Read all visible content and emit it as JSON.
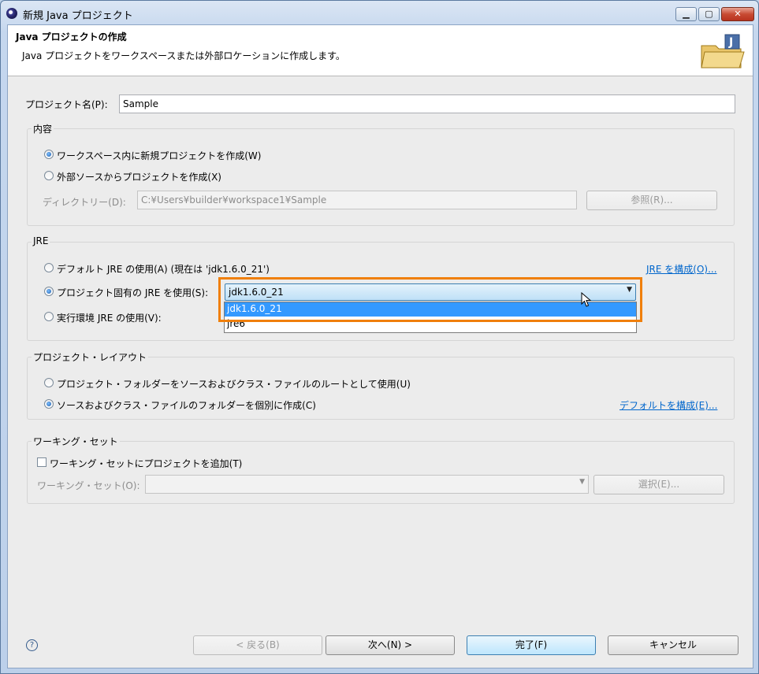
{
  "window": {
    "title": "新規 Java プロジェクト",
    "min_label": "▁",
    "max_label": "▢",
    "close_label": "✕"
  },
  "header": {
    "title": "Java プロジェクトの作成",
    "description": "Java プロジェクトをワークスペースまたは外部ロケーションに作成します。"
  },
  "project_name": {
    "label": "プロジェクト名(P):",
    "value": "Sample"
  },
  "contents": {
    "legend": "内容",
    "option_workspace": "ワークスペース内に新規プロジェクトを作成(W)",
    "option_external": "外部ソースからプロジェクトを作成(X)",
    "directory_label": "ディレクトリー(D):",
    "directory_value": "C:¥Users¥builder¥workspace1¥Sample",
    "browse_button": "参照(R)..."
  },
  "jre": {
    "legend": "JRE",
    "option_default": "デフォルト JRE の使用(A) (現在は 'jdk1.6.0_21')",
    "configure_link": "JRE を構成(O)...",
    "option_project": "プロジェクト固有の JRE を使用(S):",
    "option_env": "実行環境 JRE の使用(V):",
    "combo_value": "jdk1.6.0_21",
    "dropdown_options": [
      "jdk1.6.0_21",
      "jre6"
    ]
  },
  "layout": {
    "legend": "プロジェクト・レイアウト",
    "option_root": "プロジェクト・フォルダーをソースおよびクラス・ファイルのルートとして使用(U)",
    "option_separate": "ソースおよびクラス・ファイルのフォルダーを個別に作成(C)",
    "configure_link": "デフォルトを構成(E)..."
  },
  "working_set": {
    "legend": "ワーキング・セット",
    "add_checkbox": "ワーキング・セットにプロジェクトを追加(T)",
    "set_label": "ワーキング・セット(O):",
    "select_button": "選択(E)..."
  },
  "footer": {
    "help": "?",
    "back_button": "< 戻る(B)",
    "next_button": "次へ(N) >",
    "finish_button": "完了(F)",
    "cancel_button": "キャンセル"
  },
  "colors": {
    "highlight": "#f07f0a",
    "selection": "#3399ff",
    "link": "#0066cc"
  }
}
